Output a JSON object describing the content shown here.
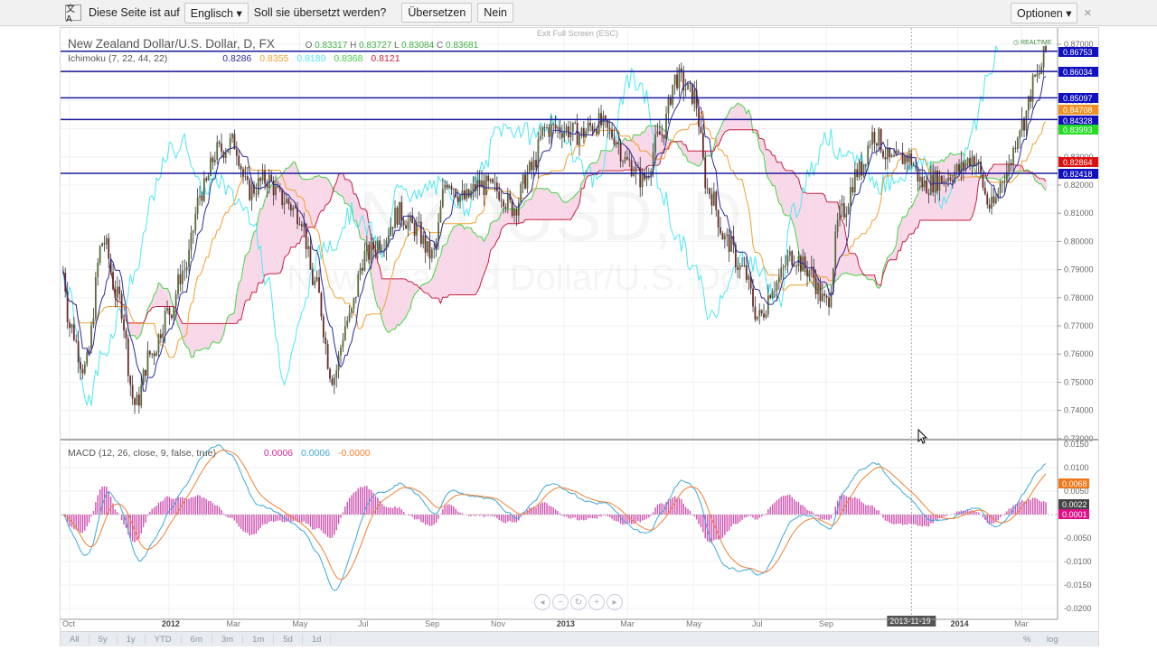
{
  "translate_bar": {
    "icon": "translate-icon",
    "prefix": "Diese Seite ist auf",
    "language": "Englisch",
    "question": "Soll sie übersetzt werden?",
    "translate_button": "Übersetzen",
    "no_button": "Nein",
    "options_button": "Optionen",
    "close": "×"
  },
  "header": {
    "exit_fullscreen": "Exit Full Screen (ESC)",
    "realtime": "REALTIME"
  },
  "symbol": {
    "title": "New Zealand Dollar/U.S. Dollar, D, FX",
    "o_label": "O",
    "o": "0.83317",
    "h_label": "H",
    "h": "0.83727",
    "l_label": "L",
    "l": "0.83084",
    "c_label": "C",
    "c": "0.83681",
    "watermark_ticker": "NZDUSD, D",
    "watermark_name": "New Zealand Dollar/U.S. Dollar"
  },
  "ichimoku": {
    "label": "Ichimoku (7, 22, 44, 22)",
    "values": [
      "0.8286",
      "0.8355",
      "0.8189",
      "0.8368",
      "0.8121"
    ],
    "colors": [
      "#2b2b9a",
      "#f0a030",
      "#4ee8f0",
      "#44d444",
      "#c82040"
    ]
  },
  "macd": {
    "label": "MACD (12, 26, close, 9, false, true)",
    "values": [
      "0.0006",
      "0.0006",
      "-0.0000"
    ],
    "colors": [
      "#d42a9a",
      "#3fa8d8",
      "#f08030"
    ]
  },
  "colors": {
    "hline": "#1a1a9a",
    "candle": "#3a3a2a",
    "cloud": "#f8d8e8",
    "histogram": "#d050b0"
  },
  "chart_data": [
    {
      "type": "candlestick",
      "title": "New Zealand Dollar/U.S. Dollar, D, FX",
      "ylim": [
        0.73,
        0.875
      ],
      "yticks": [
        "0.87000",
        "0.86000",
        "0.85000",
        "0.84000",
        "0.83000",
        "0.82000",
        "0.81000",
        "0.80000",
        "0.79000",
        "0.78000",
        "0.77000",
        "0.76000",
        "0.75000",
        "0.74000",
        "0.73000"
      ],
      "xticks": [
        {
          "label": "Oct",
          "bold": false
        },
        {
          "label": "2012",
          "bold": true
        },
        {
          "label": "Mar",
          "bold": false
        },
        {
          "label": "May",
          "bold": false
        },
        {
          "label": "Jul",
          "bold": false
        },
        {
          "label": "Sep",
          "bold": false
        },
        {
          "label": "Nov",
          "bold": false
        },
        {
          "label": "2013",
          "bold": true
        },
        {
          "label": "Mar",
          "bold": false
        },
        {
          "label": "May",
          "bold": false
        },
        {
          "label": "Jul",
          "bold": false
        },
        {
          "label": "Sep",
          "bold": false
        },
        {
          "label": "2013-11-19",
          "bold": false
        },
        {
          "label": "2014",
          "bold": true
        },
        {
          "label": "Mar",
          "bold": false
        }
      ],
      "horizontal_lines": [
        0.86753,
        0.86034,
        0.85097,
        0.84328,
        0.82418
      ],
      "price_labels": [
        {
          "v": "0.86753",
          "c": "#1010c0"
        },
        {
          "v": "0.86034",
          "c": "#1010c0"
        },
        {
          "v": "0.85097",
          "c": "#1010c0"
        },
        {
          "v": "0.84708",
          "c": "#f09020"
        },
        {
          "v": "0.84328",
          "c": "#1010c0"
        },
        {
          "v": "0.83993",
          "c": "#22dd22"
        },
        {
          "v": "0.82864",
          "c": "#dd1010"
        },
        {
          "v": "0.82418",
          "c": "#1010c0"
        }
      ],
      "close_approx": [
        [
          "2011-09-25",
          0.789
        ],
        [
          "2011-10-01",
          0.77
        ],
        [
          "2011-10-15",
          0.755
        ],
        [
          "2011-11-01",
          0.8
        ],
        [
          "2011-11-15",
          0.78
        ],
        [
          "2011-12-01",
          0.742
        ],
        [
          "2011-12-15",
          0.76
        ],
        [
          "2012-01-01",
          0.775
        ],
        [
          "2012-01-15",
          0.79
        ],
        [
          "2012-02-01",
          0.818
        ],
        [
          "2012-02-15",
          0.832
        ],
        [
          "2012-03-01",
          0.835
        ],
        [
          "2012-03-15",
          0.818
        ],
        [
          "2012-04-01",
          0.822
        ],
        [
          "2012-04-15",
          0.815
        ],
        [
          "2012-05-01",
          0.81
        ],
        [
          "2012-05-15",
          0.785
        ],
        [
          "2012-06-01",
          0.752
        ],
        [
          "2012-06-15",
          0.772
        ],
        [
          "2012-07-01",
          0.795
        ],
        [
          "2012-07-15",
          0.8
        ],
        [
          "2012-08-01",
          0.81
        ],
        [
          "2012-08-15",
          0.805
        ],
        [
          "2012-09-01",
          0.795
        ],
        [
          "2012-09-15",
          0.822
        ],
        [
          "2012-10-01",
          0.815
        ],
        [
          "2012-10-15",
          0.82
        ],
        [
          "2012-11-01",
          0.818
        ],
        [
          "2012-11-15",
          0.812
        ],
        [
          "2012-12-01",
          0.825
        ],
        [
          "2012-12-15",
          0.84
        ],
        [
          "2013-01-01",
          0.84
        ],
        [
          "2013-01-15",
          0.838
        ],
        [
          "2013-02-01",
          0.842
        ],
        [
          "2013-02-15",
          0.838
        ],
        [
          "2013-03-01",
          0.828
        ],
        [
          "2013-03-15",
          0.822
        ],
        [
          "2013-04-01",
          0.838
        ],
        [
          "2013-04-15",
          0.858
        ],
        [
          "2013-05-01",
          0.852
        ],
        [
          "2013-05-15",
          0.818
        ],
        [
          "2013-06-01",
          0.8
        ],
        [
          "2013-06-15",
          0.79
        ],
        [
          "2013-07-01",
          0.773
        ],
        [
          "2013-07-15",
          0.785
        ],
        [
          "2013-08-01",
          0.795
        ],
        [
          "2013-08-15",
          0.79
        ],
        [
          "2013-09-01",
          0.778
        ],
        [
          "2013-09-15",
          0.81
        ],
        [
          "2013-10-01",
          0.825
        ],
        [
          "2013-10-15",
          0.838
        ],
        [
          "2013-11-01",
          0.828
        ],
        [
          "2013-11-15",
          0.83
        ],
        [
          "2013-12-01",
          0.82
        ],
        [
          "2013-12-15",
          0.822
        ],
        [
          "2014-01-01",
          0.825
        ],
        [
          "2014-01-15",
          0.83
        ],
        [
          "2014-02-01",
          0.812
        ],
        [
          "2014-02-15",
          0.825
        ],
        [
          "2014-03-01",
          0.842
        ],
        [
          "2014-03-15",
          0.858
        ],
        [
          "2014-03-25",
          0.868
        ]
      ]
    },
    {
      "type": "macd",
      "ylim": [
        -0.021,
        0.0155
      ],
      "yticks": [
        "0.0150",
        "0.0100",
        "0.0050",
        "-0.0050",
        "-0.0100",
        "-0.0150",
        "-0.0200"
      ],
      "price_labels": [
        {
          "v": "0.0068",
          "c": "#f07818"
        },
        {
          "v": "0.0022",
          "c": "#444444"
        },
        {
          "v": "0.0001",
          "c": "#e0108a"
        }
      ]
    }
  ],
  "range_buttons": [
    "All",
    "5y",
    "1y",
    "YTD",
    "6m",
    "3m",
    "1m",
    "5d",
    "1d"
  ],
  "scale_buttons": [
    "%",
    "log"
  ]
}
